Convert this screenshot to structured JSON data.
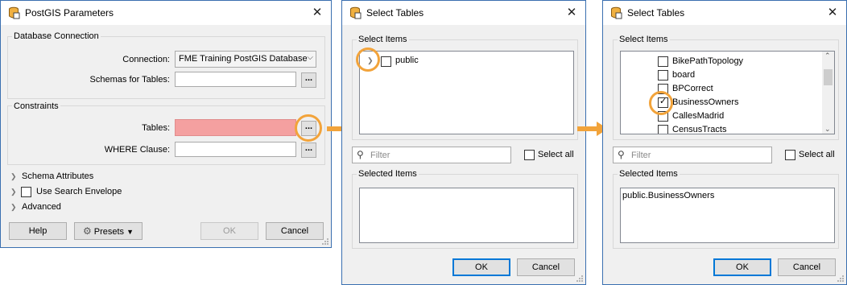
{
  "colors": {
    "accent": "#f2a33a",
    "error_field": "#f4a0a0",
    "border": "#3a6fb0"
  },
  "dialog1": {
    "title": "PostGIS Parameters",
    "db_group": "Database Connection",
    "connection_label": "Connection:",
    "connection_value": "FME Training PostGIS Database",
    "schemas_label": "Schemas for Tables:",
    "schemas_value": "",
    "ellipsis": "...",
    "constraints_group": "Constraints",
    "tables_label": "Tables:",
    "tables_value": "",
    "where_label": "WHERE Clause:",
    "where_value": "",
    "schema_attributes": "Schema Attributes",
    "use_search_envelope": "Use Search Envelope",
    "advanced": "Advanced",
    "help": "Help",
    "presets": "Presets",
    "ok": "OK",
    "cancel": "Cancel"
  },
  "dialog2": {
    "title": "Select Tables",
    "select_items": "Select Items",
    "tree_item": "public",
    "filter_placeholder": "Filter",
    "select_all": "Select all",
    "selected_items": "Selected Items",
    "ok": "OK",
    "cancel": "Cancel"
  },
  "dialog3": {
    "title": "Select Tables",
    "select_items": "Select Items",
    "items": [
      {
        "label": "BikePathTopology",
        "checked": false
      },
      {
        "label": "board",
        "checked": false
      },
      {
        "label": "BPCorrect",
        "checked": false
      },
      {
        "label": "BusinessOwners",
        "checked": true
      },
      {
        "label": "CallesMadrid",
        "checked": false
      },
      {
        "label": "CensusTracts",
        "checked": false
      }
    ],
    "filter_placeholder": "Filter",
    "select_all": "Select all",
    "selected_items": "Selected Items",
    "selected_value": "public.BusinessOwners",
    "ok": "OK",
    "cancel": "Cancel"
  }
}
